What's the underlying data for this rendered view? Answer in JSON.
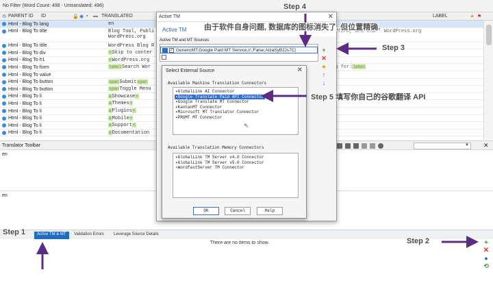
{
  "filter_bar": {
    "text": "No Filter (Word Count: 498 - Untranslated: 498)"
  },
  "grid": {
    "headers": {
      "parent_id": "PARENT ID",
      "id": "ID",
      "translated": "TRANSLATED",
      "label": "LABEL"
    },
    "rows": [
      {
        "pid": "Html - Blog To lang",
        "tr": "en",
        "right": ""
      },
      {
        "pid": "Html - Blog To title",
        "tr": "Blog Tool, Publi",
        "right": "atform, and CMS - WordPress.org"
      },
      {
        "pid": "",
        "tr": "WordPress.org",
        "right": ""
      },
      {
        "pid": "Html - Blog To title",
        "tr": "WordPress Blog R",
        "right": ""
      },
      {
        "pid": "Html - Blog To div",
        "tr": "Skip to conter",
        "right": ""
      },
      {
        "pid": "Html - Blog To h1",
        "tr": "WordPress.org",
        "right": ""
      },
      {
        "pid": "Html - Blog To form",
        "tr": "Search Wor",
        "right": "rg for:"
      },
      {
        "pid": "Html - Blog To value",
        "tr": "",
        "right": ""
      },
      {
        "pid": "Html - Blog To button",
        "tr": "Submit",
        "right": ""
      },
      {
        "pid": "Html - Blog To button",
        "tr": "Toggle Menu",
        "right": ""
      },
      {
        "pid": "Html - Blog To li",
        "tr": "Showcase",
        "right": ""
      },
      {
        "pid": "Html - Blog To li",
        "tr": "Themes",
        "right": ""
      },
      {
        "pid": "Html - Blog To li",
        "tr": "Plugins",
        "right": ""
      },
      {
        "pid": "Html - Blog To li",
        "tr": "Mobile",
        "right": ""
      },
      {
        "pid": "Html - Blog To li",
        "tr": "Support",
        "right": ""
      },
      {
        "pid": "Html - Blog To li",
        "tr": "Documentation",
        "right": ""
      }
    ]
  },
  "translator_toolbar": {
    "label": "Translator Toolbar"
  },
  "source_pane": {
    "text": "en"
  },
  "target_pane": {
    "text": "en"
  },
  "bottom_tabs": [
    "Active TM & MT",
    "Validation Errors",
    "Leverage Source Details"
  ],
  "bottom_panel": {
    "empty_text": "There are no items to show."
  },
  "active_tm_dialog": {
    "title": "Active TM",
    "header": "Active TM",
    "sources_label": "Active TM and MT Sources",
    "source_row": "GenericMT;Google Paid MT Service;//;;False;AIzaSyBJJs7C",
    "source_row_suffix": "|"
  },
  "external_source_dialog": {
    "title": "Select External Source",
    "mt_label": "Available Machine Translation Connectors",
    "mt_items": [
      "GlobalLink AI Connector",
      "Google Translate Paid API Connector",
      "Google Translate MT Connector",
      "KantanMT Connector",
      "Microsoft MT Translator Connector",
      "PROMT MT Connector"
    ],
    "tm_label": "Available Translation Memory Connectors",
    "tm_items": [
      "GlobalLink TM Server v4.0 Connector",
      "GlobalLink TM Server v5.0 Connector",
      "WordfastServer TM Connector"
    ],
    "buttons": {
      "ok": "OK",
      "cancel": "Cancel",
      "help": "Help"
    }
  },
  "annotations": {
    "step1": "Step 1",
    "step2": "Step 2",
    "step3": "Step 3",
    "step4": "Step 4",
    "step5": "Step 5  填写你自己的谷歌翻译 API",
    "note": "由于软件自身问题, 数据库的图标消失了, 但位置精确."
  },
  "colors": {
    "accent": "#1e6bc4",
    "arrow": "#5a2d82",
    "selected_row": "#d7e6f7"
  }
}
